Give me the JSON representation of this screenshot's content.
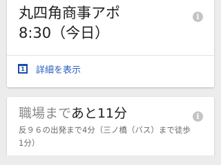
{
  "event_card": {
    "title": "丸四角商事アポ",
    "time": "8:30（今日）",
    "details_label": "詳細を表示",
    "calendar_day": "1",
    "info_icon": "info-icon"
  },
  "commute_card": {
    "title_prefix": "職場まで",
    "title_main": "あと11分",
    "description": "反９６の出発まで4分（三ノ橋（バス）まで徒歩1分）",
    "info_icon": "info-icon"
  },
  "colors": {
    "link": "#2a5ec0",
    "calendar_icon": "#1a4aa8",
    "background": "#ececec"
  }
}
